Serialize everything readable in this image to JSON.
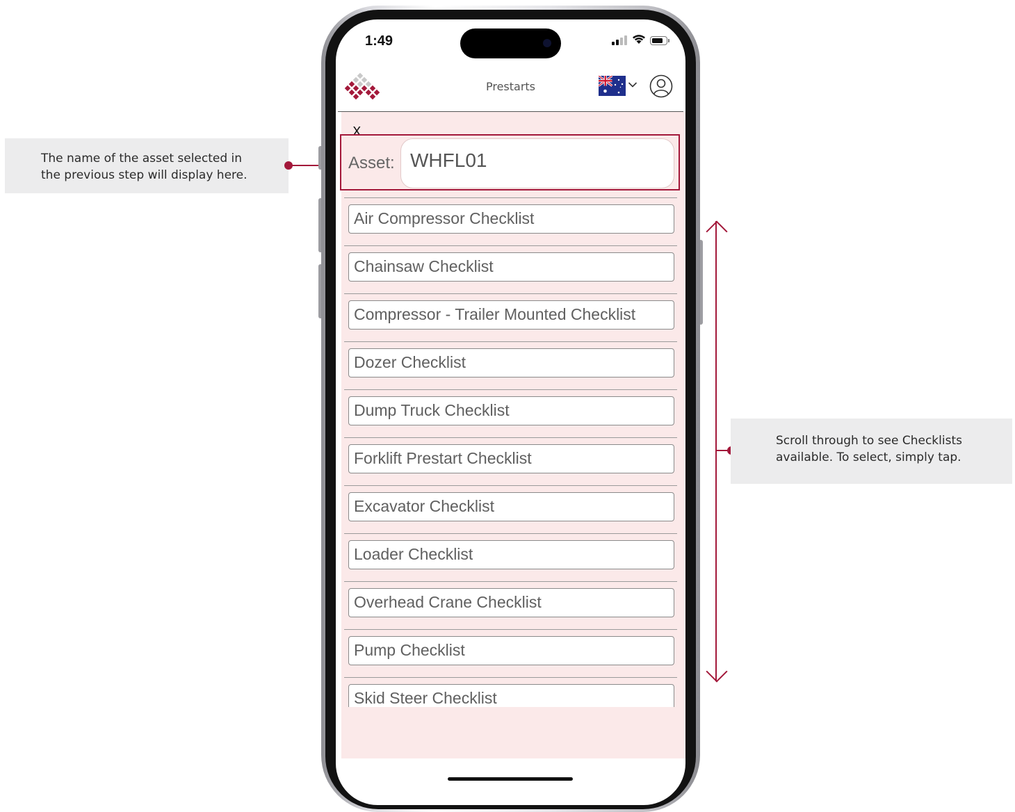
{
  "annotations": {
    "asset_note": [
      "The name of the asset selected in",
      "the previous step will display here."
    ],
    "scroll_note": [
      "Scroll through to see Checklists",
      "available. To select, simply tap."
    ],
    "accent_color": "#a3183a"
  },
  "status_bar": {
    "time": "1:49"
  },
  "header": {
    "title": "Prestarts",
    "language_flag": "australia-flag-icon"
  },
  "asset": {
    "close_label": "X",
    "label": "Asset:",
    "value": "WHFL01"
  },
  "checklists": [
    "Air Compressor Checklist",
    "Chainsaw Checklist",
    "Compressor - Trailer Mounted Checklist",
    "Dozer Checklist",
    "Dump Truck Checklist",
    "Forklift Prestart Checklist",
    "Excavator Checklist",
    "Loader Checklist",
    "Overhead Crane Checklist",
    "Pump Checklist",
    "Skid Steer Checklist"
  ],
  "colors": {
    "content_bg": "#fbe9e9",
    "highlight": "#a3183a"
  }
}
